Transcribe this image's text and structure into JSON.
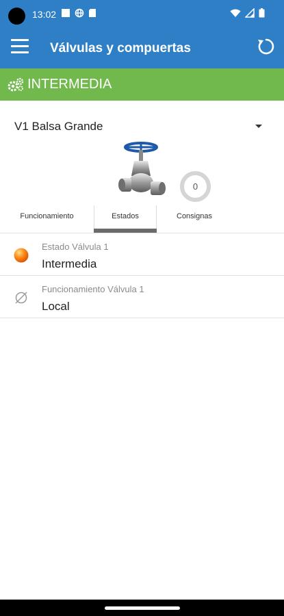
{
  "status_bar": {
    "time": "13:02",
    "left_icons": [
      "square-notification-icon",
      "globe-icon",
      "sd-card-icon"
    ],
    "right_icons": [
      "wifi-icon",
      "signal-icon",
      "battery-icon"
    ]
  },
  "app_bar": {
    "title": "Válvulas y compuertas",
    "menu_icon": "hamburger-menu-icon",
    "refresh_icon": "refresh-icon",
    "color": "#2f7fc6"
  },
  "section": {
    "title": "INTERMEDIA",
    "icon": "gears-icon",
    "color": "#71b94c"
  },
  "selector": {
    "value": "V1 Balsa Grande"
  },
  "device": {
    "image": "valve-image",
    "counter": "0"
  },
  "tabs": [
    {
      "label": "Funcionamiento",
      "active": false
    },
    {
      "label": "Estados",
      "active": true
    },
    {
      "label": "Consignas",
      "active": false
    }
  ],
  "rows": [
    {
      "label": "Estado Válvula 1",
      "value": "Intermedia",
      "icon": "orange-status-dot-icon"
    },
    {
      "label": "Funcionamiento Válvula 1",
      "value": "Local",
      "icon": "empty-set-icon"
    }
  ]
}
